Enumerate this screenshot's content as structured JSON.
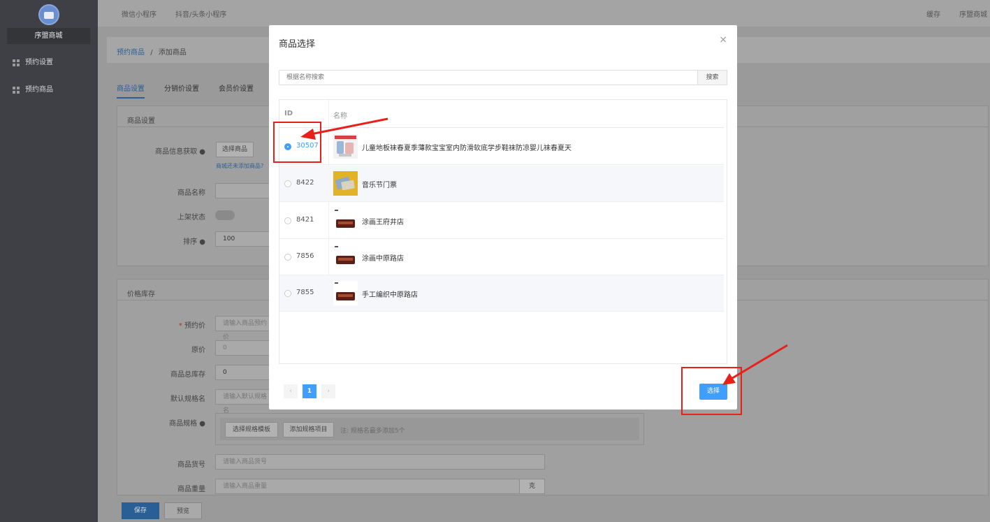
{
  "sidebar": {
    "shop_name": "序盟商城",
    "items": [
      {
        "label": "预约设置",
        "icon": "grid-icon"
      },
      {
        "label": "预约商品",
        "icon": "grid-icon"
      }
    ]
  },
  "topbar": {
    "links": [
      "微信小程序",
      "抖音/头条小程序"
    ],
    "right": [
      "缓存",
      "序盟商城"
    ]
  },
  "breadcrumb": {
    "parent": "预约商品",
    "sep": "/",
    "current": "添加商品"
  },
  "tabs": [
    "商品设置",
    "分销价设置",
    "会员价设置"
  ],
  "goods_section": {
    "title": "商品设置",
    "info_label": "商品信息获取",
    "select_goods_btn": "选择商品",
    "hint": "商城还未添加商品?",
    "name_label": "商品名称",
    "status_label": "上架状态",
    "sort_label": "排序",
    "sort_value": "100"
  },
  "price_section": {
    "title": "价格库存",
    "book_price_label": "预约价",
    "book_price_placeholder": "请输入商品预约价",
    "original_label": "原价",
    "original_value": "0",
    "stock_label": "商品总库存",
    "stock_value": "0",
    "spec_name_label": "默认规格名",
    "spec_name_placeholder": "请输入默认规格名",
    "spec_label": "商品规格",
    "spec_template_btn": "选择规格模板",
    "spec_add_btn": "添加规格项目",
    "spec_note": "注: 规格名最多添加5个",
    "code_label": "商品货号",
    "code_placeholder": "请输入商品货号",
    "weight_label": "商品重量",
    "weight_placeholder": "请输入商品重量",
    "weight_unit": "克"
  },
  "footer": {
    "save": "保存",
    "preview": "预览"
  },
  "modal": {
    "title": "商品选择",
    "close": "×",
    "search_placeholder": "根据名称搜索",
    "search_btn": "搜索",
    "columns": [
      "ID",
      "名称"
    ],
    "rows": [
      {
        "id": "30507",
        "name": "儿童地板袜春夏季薄款宝宝室内防滑软底学步鞋袜防凉婴儿袜春夏天",
        "selected": true
      },
      {
        "id": "8422",
        "name": "音乐节门票",
        "selected": false
      },
      {
        "id": "8421",
        "name": "涂画王府井店",
        "selected": false
      },
      {
        "id": "7856",
        "name": "涂画中原路店",
        "selected": false
      },
      {
        "id": "7855",
        "name": "手工编织中原路店",
        "selected": false
      }
    ],
    "pager": {
      "prev": "‹",
      "current": "1",
      "next": "›"
    },
    "choose_btn": "选择"
  },
  "colors": {
    "accent": "#409eff",
    "annotation": "#e8201a",
    "sidebar": "#3e4045"
  }
}
